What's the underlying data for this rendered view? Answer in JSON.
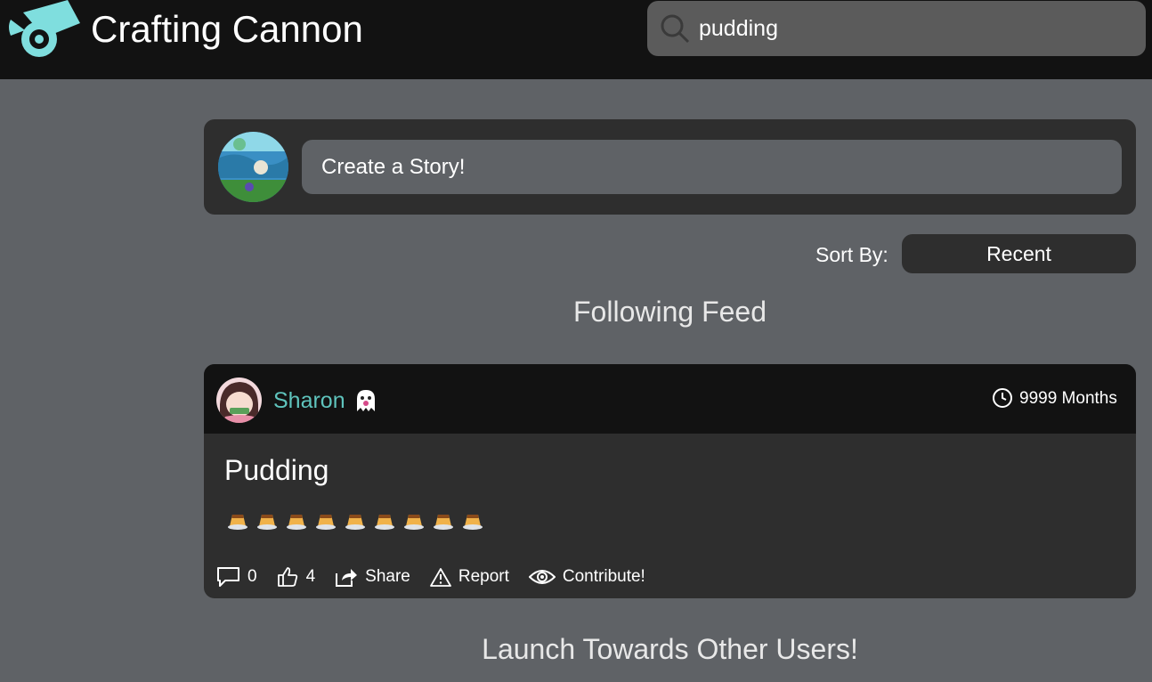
{
  "app": {
    "title": "Crafting Cannon"
  },
  "search": {
    "value": "pudding"
  },
  "composer": {
    "button_label": "Create a Story!"
  },
  "sort": {
    "label": "Sort By:",
    "selected": "Recent"
  },
  "feed": {
    "title": "Following Feed",
    "posts": [
      {
        "author": "Sharon",
        "badge_icon": "ghost-icon",
        "time": "9999 Months",
        "title": "Pudding",
        "body_emoji": "🍮🍮🍮🍮🍮🍮🍮🍮🍮",
        "comments": "0",
        "likes": "4",
        "share_label": "Share",
        "report_label": "Report",
        "contribute_label": "Contribute!"
      }
    ]
  },
  "launch": {
    "title": "Launch Towards Other Users!"
  },
  "colors": {
    "header": "#121212",
    "background": "#5f6266",
    "card": "#2e2e2e",
    "accent": "#5fc4bd",
    "logo": "#7fdede"
  }
}
